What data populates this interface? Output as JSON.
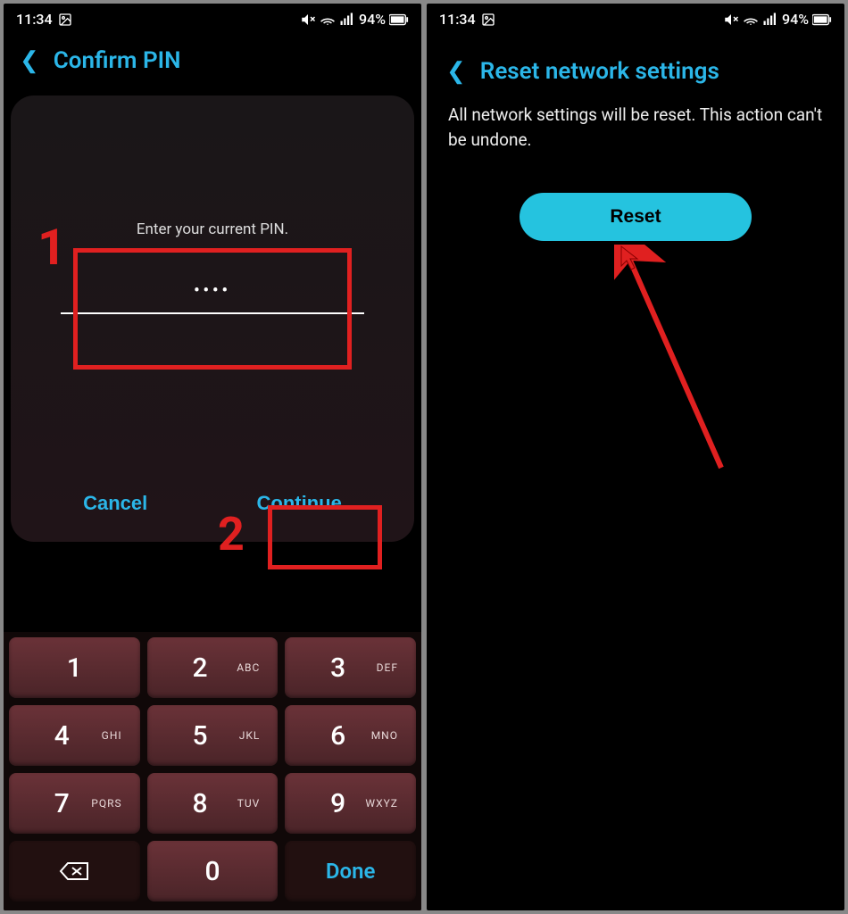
{
  "status": {
    "time": "11:34",
    "battery": "94%"
  },
  "left": {
    "title": "Confirm PIN",
    "prompt": "Enter your current PIN.",
    "dots": "••••",
    "cancel": "Cancel",
    "cont": "Continue",
    "anno1": "1",
    "anno2": "2",
    "keys": [
      {
        "n": "1",
        "l": ""
      },
      {
        "n": "2",
        "l": "ABC"
      },
      {
        "n": "3",
        "l": "DEF"
      },
      {
        "n": "4",
        "l": "GHI"
      },
      {
        "n": "5",
        "l": "JKL"
      },
      {
        "n": "6",
        "l": "MNO"
      },
      {
        "n": "7",
        "l": "PQRS"
      },
      {
        "n": "8",
        "l": "TUV"
      },
      {
        "n": "9",
        "l": "WXYZ"
      },
      {
        "n": "back",
        "l": ""
      },
      {
        "n": "0",
        "l": ""
      },
      {
        "n": "Done",
        "l": ""
      }
    ]
  },
  "right": {
    "title": "Reset network settings",
    "desc": "All network settings will be reset. This action can't be undone.",
    "reset": "Reset"
  }
}
